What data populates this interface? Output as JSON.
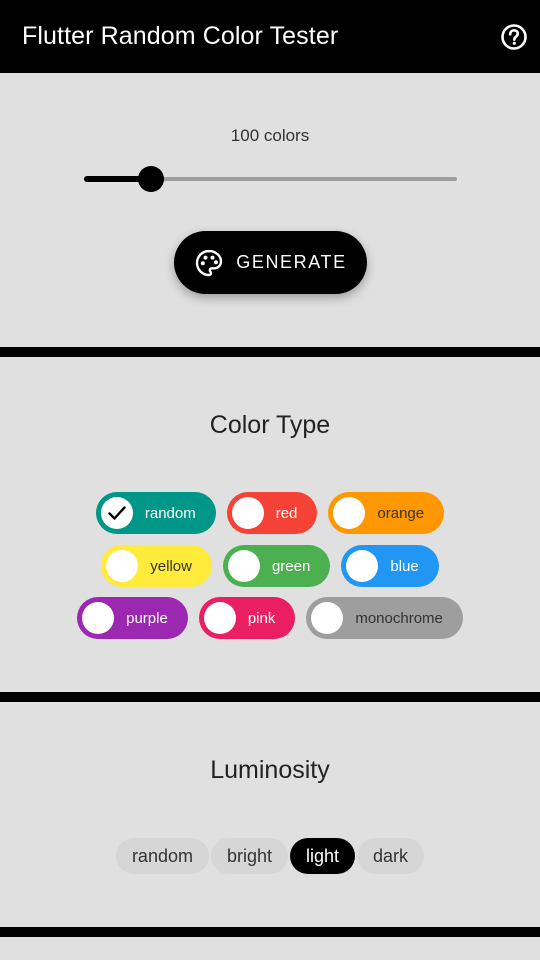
{
  "appbar": {
    "title": "Flutter Random Color Tester",
    "help_icon": "help-circle-icon"
  },
  "generator": {
    "count_label": "100 colors",
    "slider_fraction": 0.1,
    "generate_label": "GENERATE",
    "generate_icon": "palette-icon"
  },
  "color_type": {
    "heading": "Color Type",
    "rows": [
      [
        {
          "label": "random",
          "bg": "#009688",
          "fg": "#ffffff",
          "checked": true
        },
        {
          "label": "red",
          "bg": "#f44336",
          "fg": "#ffffff",
          "checked": false
        },
        {
          "label": "orange",
          "bg": "#ff9800",
          "fg": "#333333",
          "checked": false
        }
      ],
      [
        {
          "label": "yellow",
          "bg": "#ffeb3b",
          "fg": "#333333",
          "checked": false
        },
        {
          "label": "green",
          "bg": "#4caf50",
          "fg": "#ffffff",
          "checked": false
        },
        {
          "label": "blue",
          "bg": "#2196f3",
          "fg": "#ffffff",
          "checked": false
        }
      ],
      [
        {
          "label": "purple",
          "bg": "#9c27b0",
          "fg": "#ffffff",
          "checked": false
        },
        {
          "label": "pink",
          "bg": "#e91e63",
          "fg": "#ffffff",
          "checked": false
        },
        {
          "label": "monochrome",
          "bg": "#9e9e9e",
          "fg": "#333333",
          "checked": false
        }
      ]
    ]
  },
  "luminosity": {
    "heading": "Luminosity",
    "options": [
      {
        "label": "random",
        "selected": false
      },
      {
        "label": "bright",
        "selected": false
      },
      {
        "label": "light",
        "selected": true
      },
      {
        "label": "dark",
        "selected": false
      }
    ]
  }
}
